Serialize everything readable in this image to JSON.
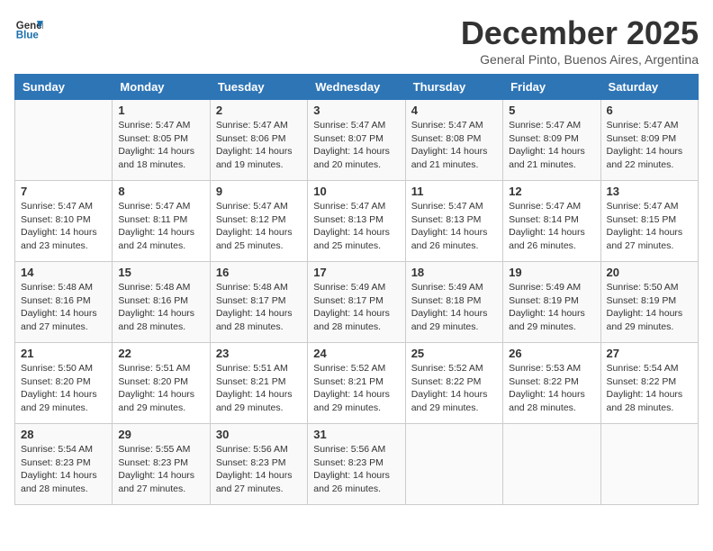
{
  "header": {
    "logo_general": "General",
    "logo_blue": "Blue",
    "month_title": "December 2025",
    "subtitle": "General Pinto, Buenos Aires, Argentina"
  },
  "weekdays": [
    "Sunday",
    "Monday",
    "Tuesday",
    "Wednesday",
    "Thursday",
    "Friday",
    "Saturday"
  ],
  "weeks": [
    [
      {
        "day": "",
        "info": ""
      },
      {
        "day": "1",
        "info": "Sunrise: 5:47 AM\nSunset: 8:05 PM\nDaylight: 14 hours\nand 18 minutes."
      },
      {
        "day": "2",
        "info": "Sunrise: 5:47 AM\nSunset: 8:06 PM\nDaylight: 14 hours\nand 19 minutes."
      },
      {
        "day": "3",
        "info": "Sunrise: 5:47 AM\nSunset: 8:07 PM\nDaylight: 14 hours\nand 20 minutes."
      },
      {
        "day": "4",
        "info": "Sunrise: 5:47 AM\nSunset: 8:08 PM\nDaylight: 14 hours\nand 21 minutes."
      },
      {
        "day": "5",
        "info": "Sunrise: 5:47 AM\nSunset: 8:09 PM\nDaylight: 14 hours\nand 21 minutes."
      },
      {
        "day": "6",
        "info": "Sunrise: 5:47 AM\nSunset: 8:09 PM\nDaylight: 14 hours\nand 22 minutes."
      }
    ],
    [
      {
        "day": "7",
        "info": "Sunrise: 5:47 AM\nSunset: 8:10 PM\nDaylight: 14 hours\nand 23 minutes."
      },
      {
        "day": "8",
        "info": "Sunrise: 5:47 AM\nSunset: 8:11 PM\nDaylight: 14 hours\nand 24 minutes."
      },
      {
        "day": "9",
        "info": "Sunrise: 5:47 AM\nSunset: 8:12 PM\nDaylight: 14 hours\nand 25 minutes."
      },
      {
        "day": "10",
        "info": "Sunrise: 5:47 AM\nSunset: 8:13 PM\nDaylight: 14 hours\nand 25 minutes."
      },
      {
        "day": "11",
        "info": "Sunrise: 5:47 AM\nSunset: 8:13 PM\nDaylight: 14 hours\nand 26 minutes."
      },
      {
        "day": "12",
        "info": "Sunrise: 5:47 AM\nSunset: 8:14 PM\nDaylight: 14 hours\nand 26 minutes."
      },
      {
        "day": "13",
        "info": "Sunrise: 5:47 AM\nSunset: 8:15 PM\nDaylight: 14 hours\nand 27 minutes."
      }
    ],
    [
      {
        "day": "14",
        "info": "Sunrise: 5:48 AM\nSunset: 8:16 PM\nDaylight: 14 hours\nand 27 minutes."
      },
      {
        "day": "15",
        "info": "Sunrise: 5:48 AM\nSunset: 8:16 PM\nDaylight: 14 hours\nand 28 minutes."
      },
      {
        "day": "16",
        "info": "Sunrise: 5:48 AM\nSunset: 8:17 PM\nDaylight: 14 hours\nand 28 minutes."
      },
      {
        "day": "17",
        "info": "Sunrise: 5:49 AM\nSunset: 8:17 PM\nDaylight: 14 hours\nand 28 minutes."
      },
      {
        "day": "18",
        "info": "Sunrise: 5:49 AM\nSunset: 8:18 PM\nDaylight: 14 hours\nand 29 minutes."
      },
      {
        "day": "19",
        "info": "Sunrise: 5:49 AM\nSunset: 8:19 PM\nDaylight: 14 hours\nand 29 minutes."
      },
      {
        "day": "20",
        "info": "Sunrise: 5:50 AM\nSunset: 8:19 PM\nDaylight: 14 hours\nand 29 minutes."
      }
    ],
    [
      {
        "day": "21",
        "info": "Sunrise: 5:50 AM\nSunset: 8:20 PM\nDaylight: 14 hours\nand 29 minutes."
      },
      {
        "day": "22",
        "info": "Sunrise: 5:51 AM\nSunset: 8:20 PM\nDaylight: 14 hours\nand 29 minutes."
      },
      {
        "day": "23",
        "info": "Sunrise: 5:51 AM\nSunset: 8:21 PM\nDaylight: 14 hours\nand 29 minutes."
      },
      {
        "day": "24",
        "info": "Sunrise: 5:52 AM\nSunset: 8:21 PM\nDaylight: 14 hours\nand 29 minutes."
      },
      {
        "day": "25",
        "info": "Sunrise: 5:52 AM\nSunset: 8:22 PM\nDaylight: 14 hours\nand 29 minutes."
      },
      {
        "day": "26",
        "info": "Sunrise: 5:53 AM\nSunset: 8:22 PM\nDaylight: 14 hours\nand 28 minutes."
      },
      {
        "day": "27",
        "info": "Sunrise: 5:54 AM\nSunset: 8:22 PM\nDaylight: 14 hours\nand 28 minutes."
      }
    ],
    [
      {
        "day": "28",
        "info": "Sunrise: 5:54 AM\nSunset: 8:23 PM\nDaylight: 14 hours\nand 28 minutes."
      },
      {
        "day": "29",
        "info": "Sunrise: 5:55 AM\nSunset: 8:23 PM\nDaylight: 14 hours\nand 27 minutes."
      },
      {
        "day": "30",
        "info": "Sunrise: 5:56 AM\nSunset: 8:23 PM\nDaylight: 14 hours\nand 27 minutes."
      },
      {
        "day": "31",
        "info": "Sunrise: 5:56 AM\nSunset: 8:23 PM\nDaylight: 14 hours\nand 26 minutes."
      },
      {
        "day": "",
        "info": ""
      },
      {
        "day": "",
        "info": ""
      },
      {
        "day": "",
        "info": ""
      }
    ]
  ]
}
